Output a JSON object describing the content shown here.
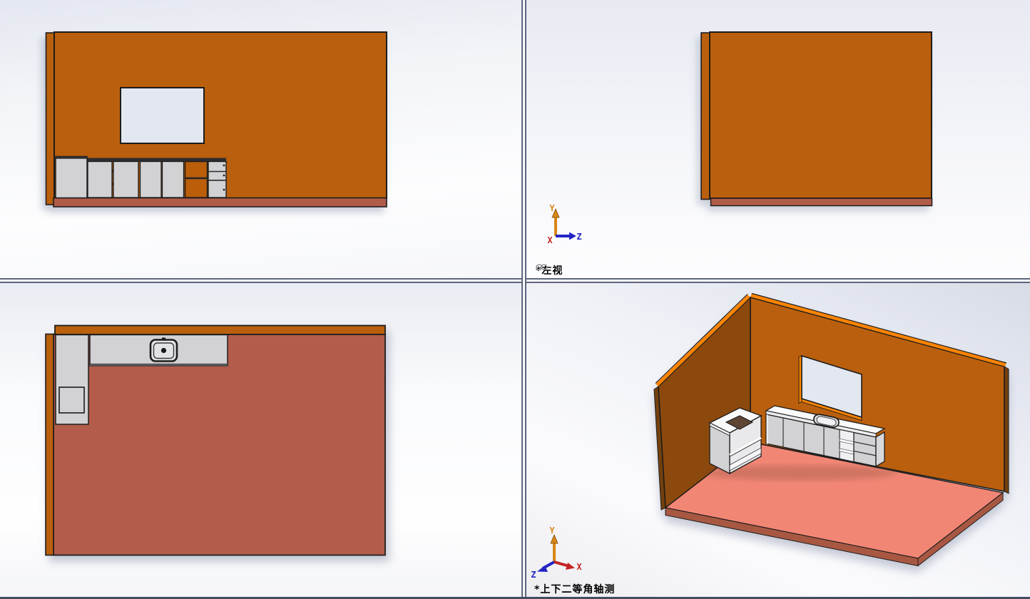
{
  "viewports": {
    "front": {
      "id": "front-view"
    },
    "left": {
      "id": "left-view",
      "label": "*左视"
    },
    "top": {
      "id": "top-view"
    },
    "iso": {
      "id": "isometric-view",
      "label": "*上下二等角轴测"
    }
  },
  "triad": {
    "x": "X",
    "y": "Y",
    "z": "Z"
  },
  "icons": {
    "view_link": "link-chain-icon"
  },
  "colors": {
    "wall_orange": "#BA5E0A",
    "wall_orange_dark": "#8C4A10",
    "wall_edge_dark": "#73400E",
    "edge_highlight": "#FF8400",
    "floor_side": "#B15B49",
    "floor_top": "#B35C4B",
    "floor_salmon": "#F28674",
    "floor_salmon_edge": "#A85843",
    "cabinet_gray": "#D2D2D4",
    "cabinet_gray_dark": "#C2C2C4",
    "cabinet_white": "#FAFAFB",
    "counter_dark": "#2E2E30",
    "window_glass": "#E3E7F0",
    "outline": "#1C1C1C",
    "axis_x_red": "#C42323",
    "axis_y_orange": "#D98617",
    "axis_z_blue": "#2424C4",
    "divider": "#5F677E",
    "label_text": "#000000",
    "sink_fill": "#E2E3E6",
    "hole_dark": "#5E4534"
  }
}
